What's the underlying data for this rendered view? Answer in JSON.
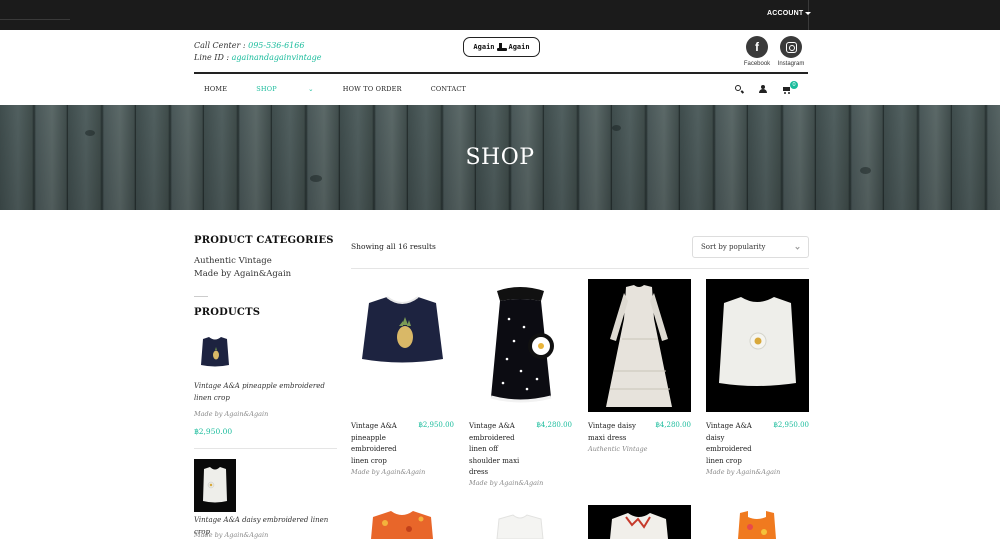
{
  "topbar": {
    "account_label": "ACCOUNT"
  },
  "header": {
    "call_center_label": "Call Center : ",
    "call_center_phone": "095-536-6166",
    "line_id_label": "Line ID : ",
    "line_id": "againandagainvintage",
    "logo_left": "Again",
    "logo_right": "Again",
    "social": [
      {
        "label": "Facebook",
        "glyph": "f"
      },
      {
        "label": "Instagram"
      }
    ]
  },
  "nav": {
    "items": [
      "HOME",
      "SHOP",
      "HOW TO ORDER",
      "CONTACT"
    ],
    "cart_count": "0"
  },
  "hero": {
    "title": "SHOP"
  },
  "sidebar": {
    "categories_heading": "PRODUCT CATEGORIES",
    "categories": [
      "Authentic Vintage",
      "Made by Again&Again"
    ],
    "products_heading": "PRODUCTS",
    "products": [
      {
        "title": "Vintage A&A pineapple embroidered linen crop",
        "category": "Made by Again&Again",
        "price": "฿2,950.00"
      },
      {
        "title": "Vintage A&A daisy embroidered linen crop",
        "category": "Made by Again&Again"
      }
    ]
  },
  "main": {
    "results_text": "Showing all 16 results",
    "sort_label": "Sort by popularity",
    "products": [
      {
        "title": "Vintage A&A pineapple embroidered linen crop",
        "price": "฿2,950.00",
        "category": "Made by Again&Again"
      },
      {
        "title": "Vintage A&A embroidered linen off shoulder maxi dress",
        "price": "฿4,280.00",
        "category": "Made by Again&Again"
      },
      {
        "title": "Vintage daisy maxi dress",
        "price": "฿4,280.00",
        "category": "Authentic Vintage"
      },
      {
        "title": "Vintage A&A daisy embroidered linen crop",
        "price": "฿2,950.00",
        "category": "Made by Again&Again"
      }
    ]
  },
  "colors": {
    "accent": "#1abc9c",
    "topbar": "#1b1b1b"
  }
}
